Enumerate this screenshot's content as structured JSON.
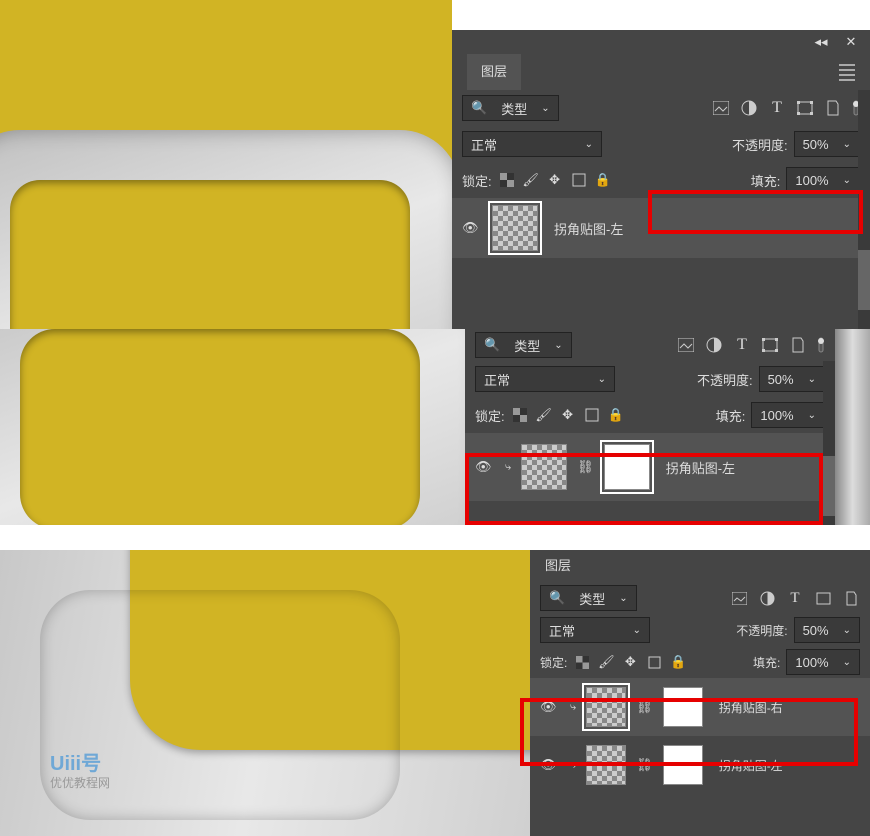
{
  "panel_title": "图层",
  "filter": {
    "search_icon": "search",
    "type_label": "类型"
  },
  "blend_mode": "正常",
  "opacity_label": "不透明度:",
  "opacity_value": "50%",
  "lock_label": "锁定:",
  "fill_label": "填充:",
  "fill_value": "100%",
  "layers": {
    "s1_layer": "拐角贴图-左",
    "s2_layer": "拐角贴图-左",
    "s3_layer1": "拐角贴图-右",
    "s3_layer2": "拐角贴图-左"
  },
  "watermark": {
    "logo": "Uiii号",
    "text": "优优教程网"
  },
  "icons": {
    "image": "image-icon",
    "adjust": "adjust-icon",
    "text": "text-icon",
    "shape": "shape-icon",
    "smart": "smart-icon"
  }
}
